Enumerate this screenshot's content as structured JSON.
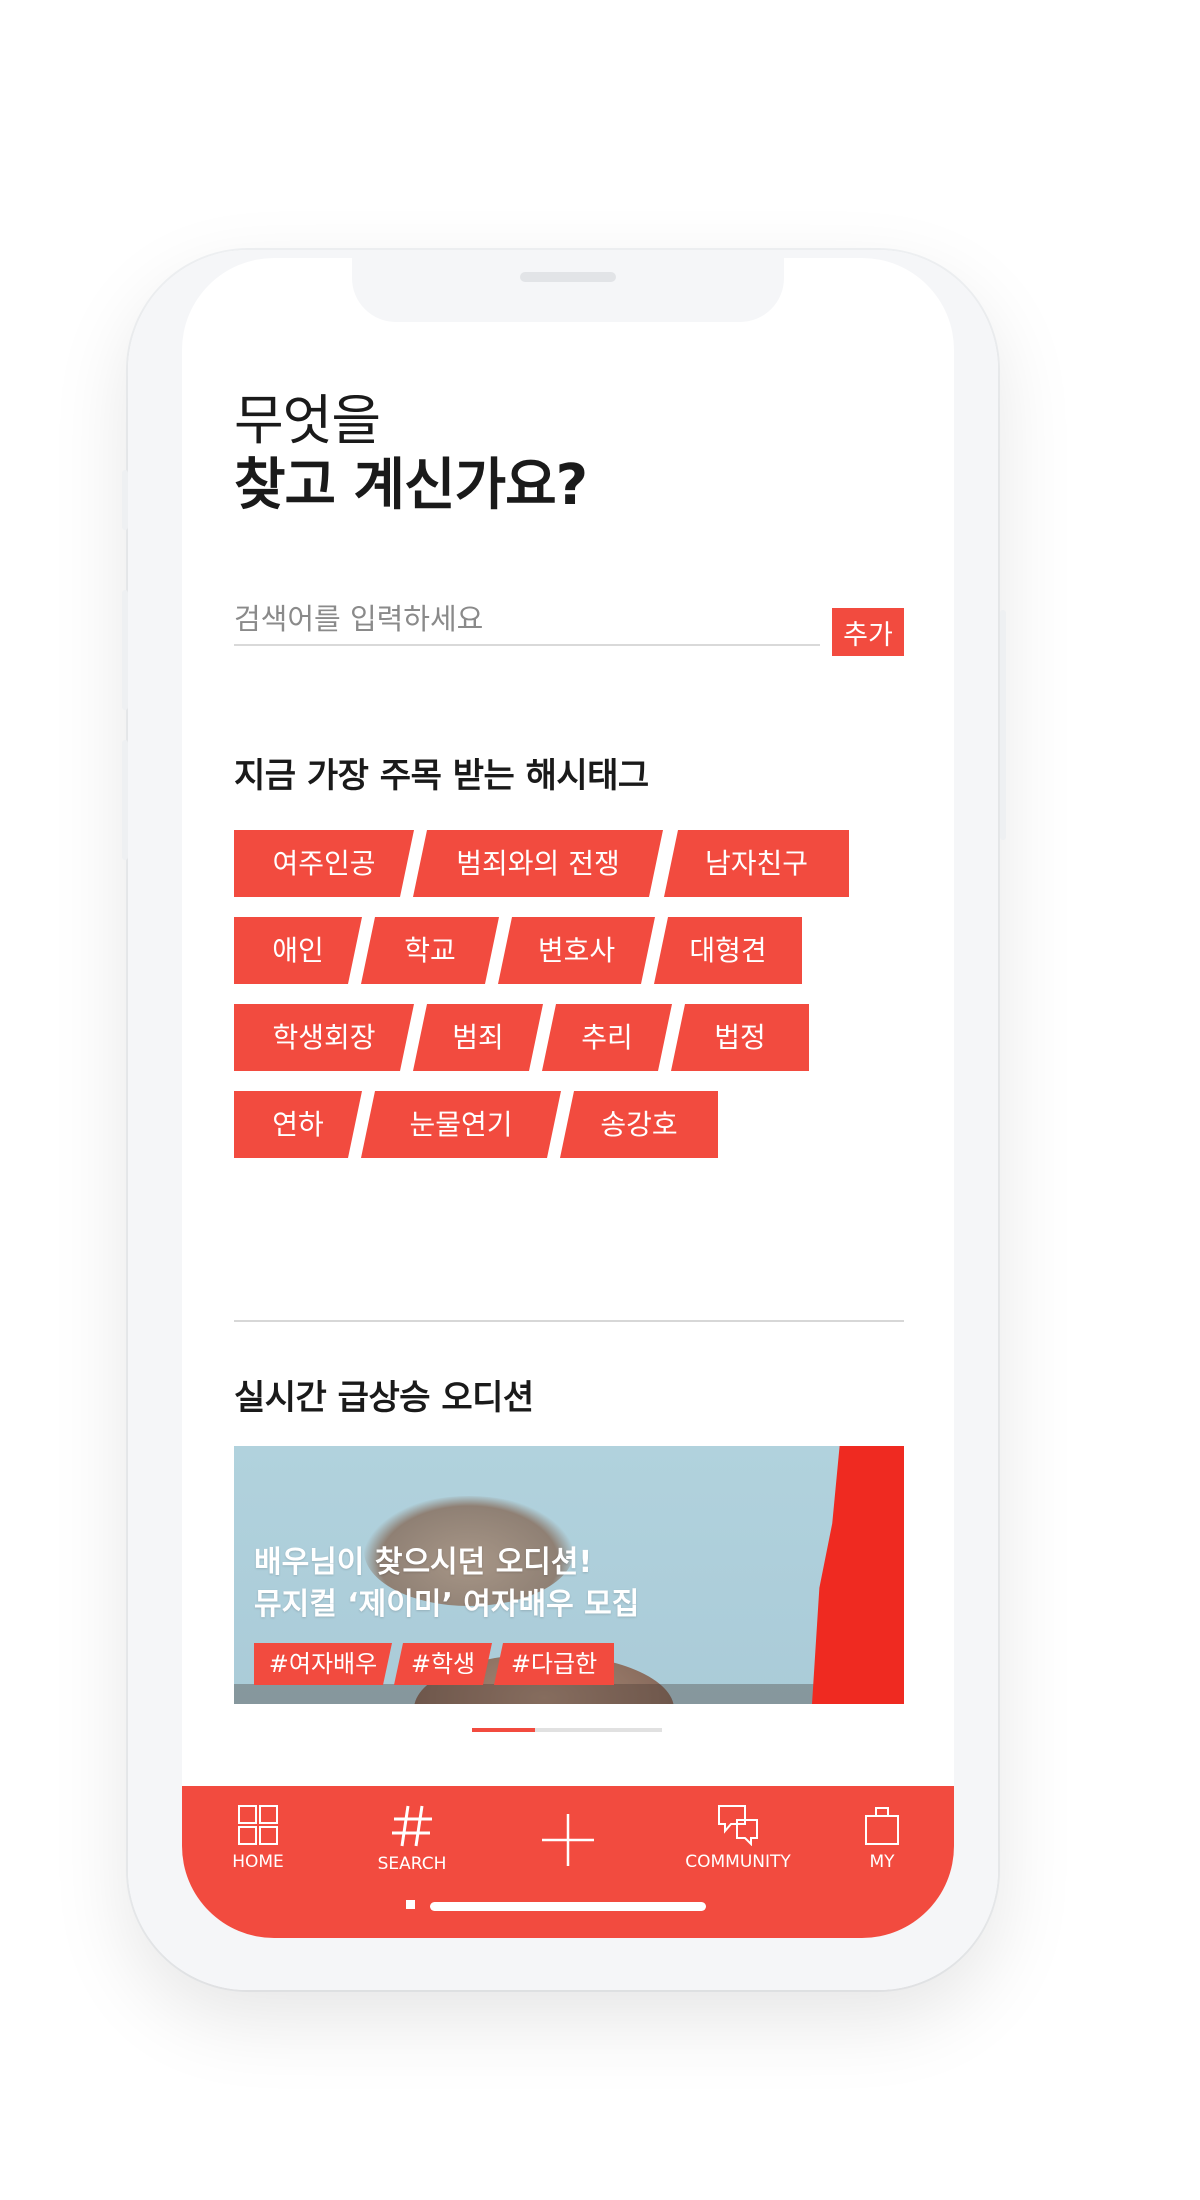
{
  "heading": {
    "line1": "무엇을",
    "line2": "찾고 계신가요?"
  },
  "search": {
    "placeholder": "검색어를 입력하세요",
    "value": "",
    "add_label": "추가"
  },
  "hashtag_section": {
    "title_regular": "지금 가장 주목 받는 ",
    "title_bold": "해시태그",
    "rows": [
      [
        "여주인공",
        "범죄와의 전쟁",
        "남자친구"
      ],
      [
        "애인",
        "학교",
        "변호사",
        "대형견"
      ],
      [
        "학생회장",
        "범죄",
        "추리",
        "법정"
      ],
      [
        "연하",
        "눈물연기",
        "송강호"
      ]
    ]
  },
  "audition_section": {
    "title_bold": "실시간 급상승",
    "title_regular": " 오디션",
    "banner": {
      "title_line1": "배우님이 찾으시던 오디션!",
      "title_line2": "뮤지컬 ‘제이미’ 여자배우 모집",
      "tags": [
        "#여자배우",
        "#학생",
        "#다급한"
      ]
    },
    "pager": {
      "current": 1,
      "total": 3
    }
  },
  "bottom_nav": {
    "items": [
      {
        "label": "HOME",
        "icon": "grid-icon"
      },
      {
        "label": "SEARCH",
        "icon": "hash-icon",
        "active": true
      },
      {
        "label": "",
        "icon": "plus-icon"
      },
      {
        "label": "COMMUNITY",
        "icon": "chat-bubbles-icon"
      },
      {
        "label": "MY",
        "icon": "bag-icon"
      }
    ]
  },
  "colors": {
    "accent": "#f24b3f",
    "text": "#1a1a1a",
    "placeholder": "#8a8a8a",
    "divider": "#d7d7d7"
  }
}
